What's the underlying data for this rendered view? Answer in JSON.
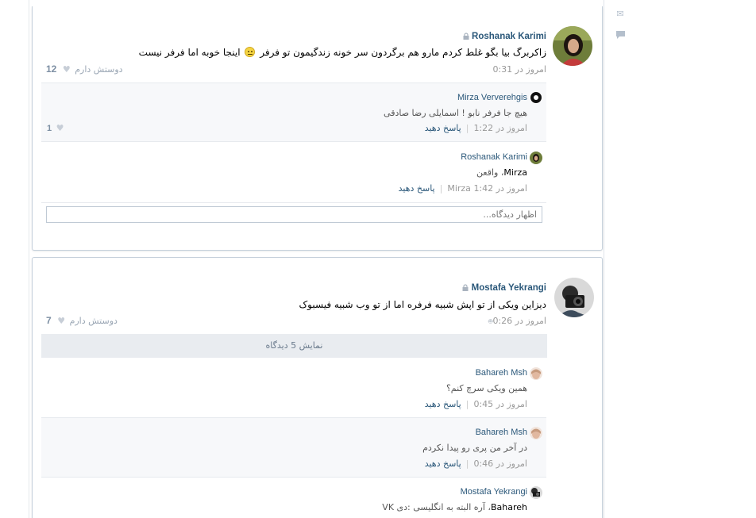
{
  "side_icons": {
    "mail": "envelope-icon",
    "comment": "speech-bubble-icon"
  },
  "posts": [
    {
      "author": "Roshanak Karimi",
      "text": "زاکربرگ بیا بگو غلط کردم مارو هم برگردون سر خونه زندگیمون تو فرفر",
      "text_after_emoji": "اینجا خوبه اما فرفر نیست",
      "time": "امروز در 0:31",
      "like_label": "دوستش دارم",
      "like_count": "12",
      "comments": [
        {
          "author": "Mirza Ververehgis",
          "text": "هیچ جا فرفر نابو ! اسمایلی رضا صادقی",
          "time": "امروز در 1:22",
          "reply": "پاسخ دهید",
          "likes": "1"
        },
        {
          "author": "Roshanak Karimi",
          "mention": "Mirza",
          "text": "، واقعن",
          "time": "امروز در 1:42",
          "reply_to": "Mirza",
          "reply": "پاسخ دهید"
        }
      ],
      "comment_placeholder": "اظهار دیدگاه..."
    },
    {
      "author": "Mostafa Yekrangi",
      "text": "دیزاین ویکی از تو اپش شبیه فرفره اما از تو وب شبیه فیسبوک",
      "time": "امروز در 0:26",
      "like_label": "دوستش دارم",
      "like_count": "7",
      "show_more": "نمایش 5 دیدگاه",
      "comments": [
        {
          "author": "Bahareh Msh",
          "text": "همین ویکی سرچ کنم؟",
          "time": "امروز در 0:45",
          "reply": "پاسخ دهید"
        },
        {
          "author": "Bahareh Msh",
          "text": "در آخر من پری رو پیدا نکردم",
          "time": "امروز در 0:46",
          "reply": "پاسخ دهید"
        },
        {
          "author": "Mostafa Yekrangi",
          "mention": "Bahareh",
          "text": "، آره البته به انگلیسی :دی VK"
        }
      ]
    }
  ]
}
